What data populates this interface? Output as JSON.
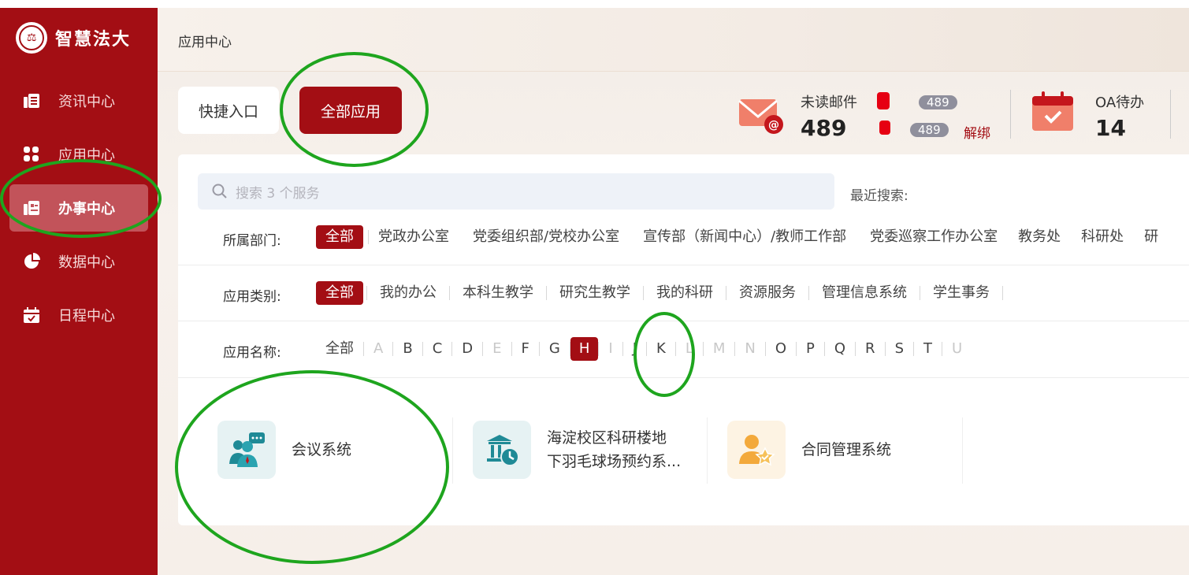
{
  "app": {
    "logo_text": "智慧法大"
  },
  "sidebar": {
    "items": [
      {
        "label": "资讯中心",
        "icon": "news-icon",
        "active": false
      },
      {
        "label": "应用中心",
        "icon": "apps-grid-icon",
        "active": false
      },
      {
        "label": "办事中心",
        "icon": "service-card-icon",
        "active": true
      },
      {
        "label": "数据中心",
        "icon": "pie-chart-icon",
        "active": false
      },
      {
        "label": "日程中心",
        "icon": "calendar-check-icon",
        "active": false
      }
    ]
  },
  "header": {
    "breadcrumb": "应用中心"
  },
  "tabs": {
    "quick": "快捷入口",
    "all": "全部应用",
    "active": "all"
  },
  "stats": {
    "mail": {
      "title": "未读邮件",
      "count": "489",
      "badge1": "489",
      "badge2": "489",
      "unbind": "解绑",
      "icon": "mail-icon"
    },
    "oa": {
      "title": "OA待办",
      "count": "14",
      "icon": "calendar-icon"
    }
  },
  "search": {
    "placeholder": "搜索 3 个服务",
    "recent_label": "最近搜索:"
  },
  "filters": {
    "department": {
      "label": "所属部门:",
      "options": [
        "全部",
        "党政办公室",
        "党委组织部/党校办公室",
        "宣传部（新闻中心）/教师工作部",
        "党委巡察工作办公室",
        "教务处",
        "科研处",
        "研"
      ]
    },
    "category": {
      "label": "应用类别:",
      "options": [
        "全部",
        "我的办公",
        "本科生教学",
        "研究生教学",
        "我的科研",
        "资源服务",
        "管理信息系统",
        "学生事务"
      ]
    },
    "name": {
      "label": "应用名称:",
      "options": [
        "全部",
        "A",
        "B",
        "C",
        "D",
        "E",
        "F",
        "G",
        "H",
        "I",
        "J",
        "K",
        "L",
        "M",
        "N",
        "O",
        "P",
        "Q",
        "R",
        "S",
        "T",
        "U"
      ],
      "active": "H",
      "disabled": [
        "A",
        "E",
        "I",
        "L",
        "M",
        "N",
        "U"
      ]
    }
  },
  "apps": [
    {
      "name": "会议系统",
      "icon": "meeting-people-icon",
      "bg": "#e6f2f3"
    },
    {
      "name_line1": "海淀校区科研楼地",
      "name_line2": "下羽毛球场预约系...",
      "icon": "building-clock-icon",
      "bg": "#e6f2f3"
    },
    {
      "name": "合同管理系统",
      "icon": "contract-user-star-icon",
      "bg": "#fdf3e3"
    }
  ],
  "colors": {
    "brand": "#a30e14",
    "annotation": "#1ea51e",
    "teal": "#1f8a96",
    "orange": "#f3a93b"
  }
}
